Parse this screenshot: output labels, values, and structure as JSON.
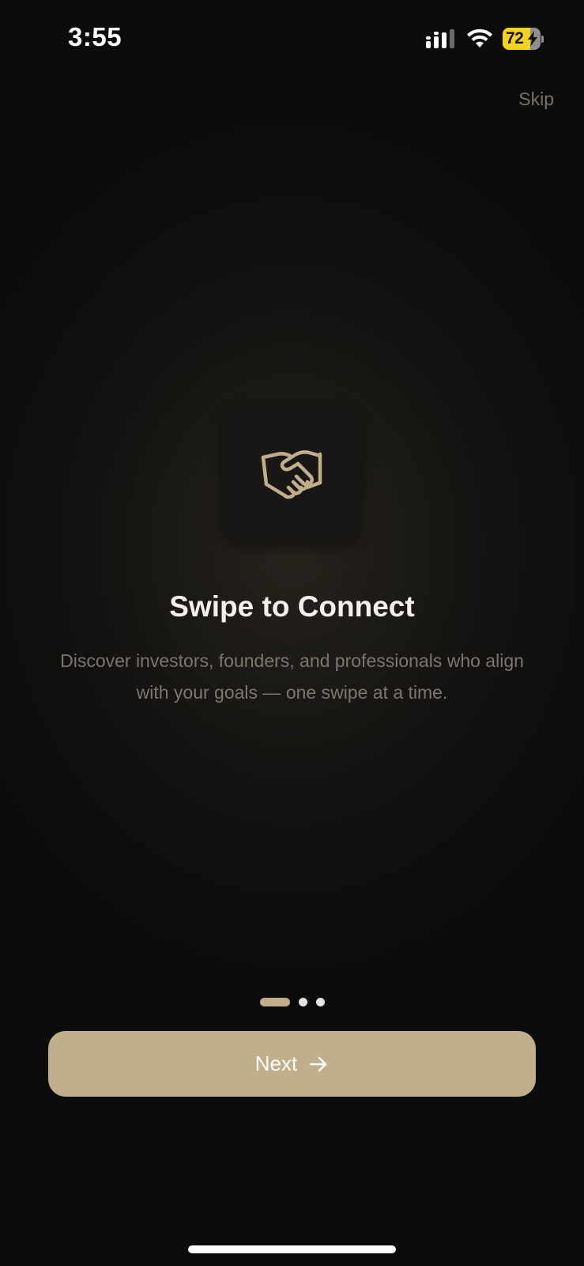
{
  "status_bar": {
    "time": "3:55",
    "battery_level": "72",
    "battery_fraction": 0.72,
    "battery_color": "#f5d21c",
    "signal_icon": "cellular-signal-icon",
    "wifi_icon": "wifi-icon",
    "charging_icon": "bolt-icon"
  },
  "header": {
    "skip_label": "Skip"
  },
  "onboarding": {
    "icon": "handshake-icon",
    "title": "Swipe to Connect",
    "description": "Discover investors, founders, and professionals who align with your goals — one swipe at a time."
  },
  "pagination": {
    "total": 3,
    "current": 1
  },
  "footer": {
    "next_label": "Next",
    "next_icon": "arrow-right-icon"
  },
  "colors": {
    "accent": "#c1ae8a",
    "background": "#0c0c0c",
    "text_primary": "#f4f1ec",
    "text_secondary": "#7d766d"
  }
}
